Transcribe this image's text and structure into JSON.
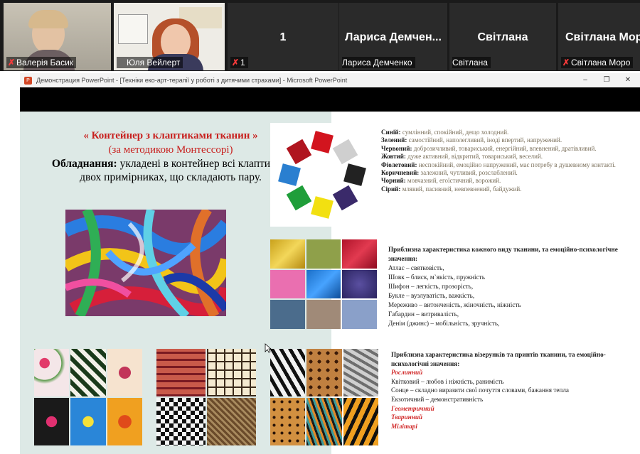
{
  "participants": [
    {
      "name": "Валерія Басик",
      "muted": true,
      "has_video": true
    },
    {
      "name": "Юля Вейлерт",
      "muted": false,
      "has_video": true,
      "speaking": true
    },
    {
      "name": "1",
      "display": "1",
      "muted": true,
      "has_video": false
    },
    {
      "name": "Лариса Демченко",
      "display": "Лариса  Демчен...",
      "muted": false,
      "has_video": false
    },
    {
      "name": "Світлана",
      "display": "Світлана",
      "muted": false,
      "has_video": false
    },
    {
      "name": "Світлана Моро",
      "display": "Світлана Мор",
      "muted": true,
      "has_video": false
    }
  ],
  "window": {
    "title": "Демонстрация PowerPoint - [Техніки еко-арт-терапії у роботі з дитячими страхами] - Microsoft PowerPoint",
    "app_icon_text": "P",
    "controls": {
      "minimize": "–",
      "restore": "❐",
      "close": "✕"
    }
  },
  "slide": {
    "heading": "« Контейнер з клаптиками тканин »",
    "subheading": "(за методикою Монтессорі)",
    "equipment_label": "Обладнання:",
    "equipment_text": " укладені в контейнер всі клаптики в двох примірниках, що складають пару.",
    "wheel_colors": [
      "#d2141e",
      "#cfcfcf",
      "#222222",
      "#3a2a6a",
      "#f2e011",
      "#1f9e3a",
      "#2a7fd0",
      "#b0151f"
    ],
    "color_meanings": [
      {
        "name": "Синій:",
        "desc": " сумлінний, спокійний, дещо холодний."
      },
      {
        "name": "Зелений:",
        "desc": " самостійний, наполегливий, іноді впертий, напружений."
      },
      {
        "name": "Червоний:",
        "desc": " доброзичливий, товариський, енергійний, впевнений, дратівливий."
      },
      {
        "name": "Жовтий:",
        "desc": " дуже активний, відкритий, товариський, веселий."
      },
      {
        "name": "Фіолетовий:",
        "desc": " неспокійний, емоційно напружений, має потребу в душевному контакті."
      },
      {
        "name": "Коричневий:",
        "desc": " залежний, чутливий, розслаблений."
      },
      {
        "name": "Чорний:",
        "desc": " мовчазний, егоїстичний, ворожий."
      },
      {
        "name": "Сірий:",
        "desc": " млявий, пасивний, невпевнений, байдужий."
      }
    ],
    "fabric_title": "Приблизна характеристика кожного виду тканини, та емоційно-психологічне значення:",
    "fabric_lines": [
      "Атлас – святковість,",
      "Шовк – блиск, м`якість, пружність",
      "Шифон – легкість, прозорість,",
      "Букле – вузлуватість, важкість,",
      "Мереживо – витонченість, жіночність, ніжність",
      "Габардин – витривалість,",
      "Денім (джинс) – мобільність, зручність,"
    ],
    "pattern_title": "Приблизна характеристика візерунків та принтів тканини, та емоційно-психологічні значення:",
    "pattern_red_1": "Рослинний",
    "pattern_lines": [
      "Квітковий – любов і ніжність, ранимість",
      "Сонце – складно виразити свої почуття словами, бажання тепла",
      "Екзотичний – демонстративність"
    ],
    "pattern_red_2": "Геометричний",
    "pattern_red_3": "Тваринний",
    "pattern_red_4": "Мілітарі"
  },
  "colors": {
    "speaking_border": "#9bd23c",
    "muted_icon": "#ff3b3b",
    "slide_bg": "#dde9e6",
    "heading_red": "#c8201e"
  }
}
